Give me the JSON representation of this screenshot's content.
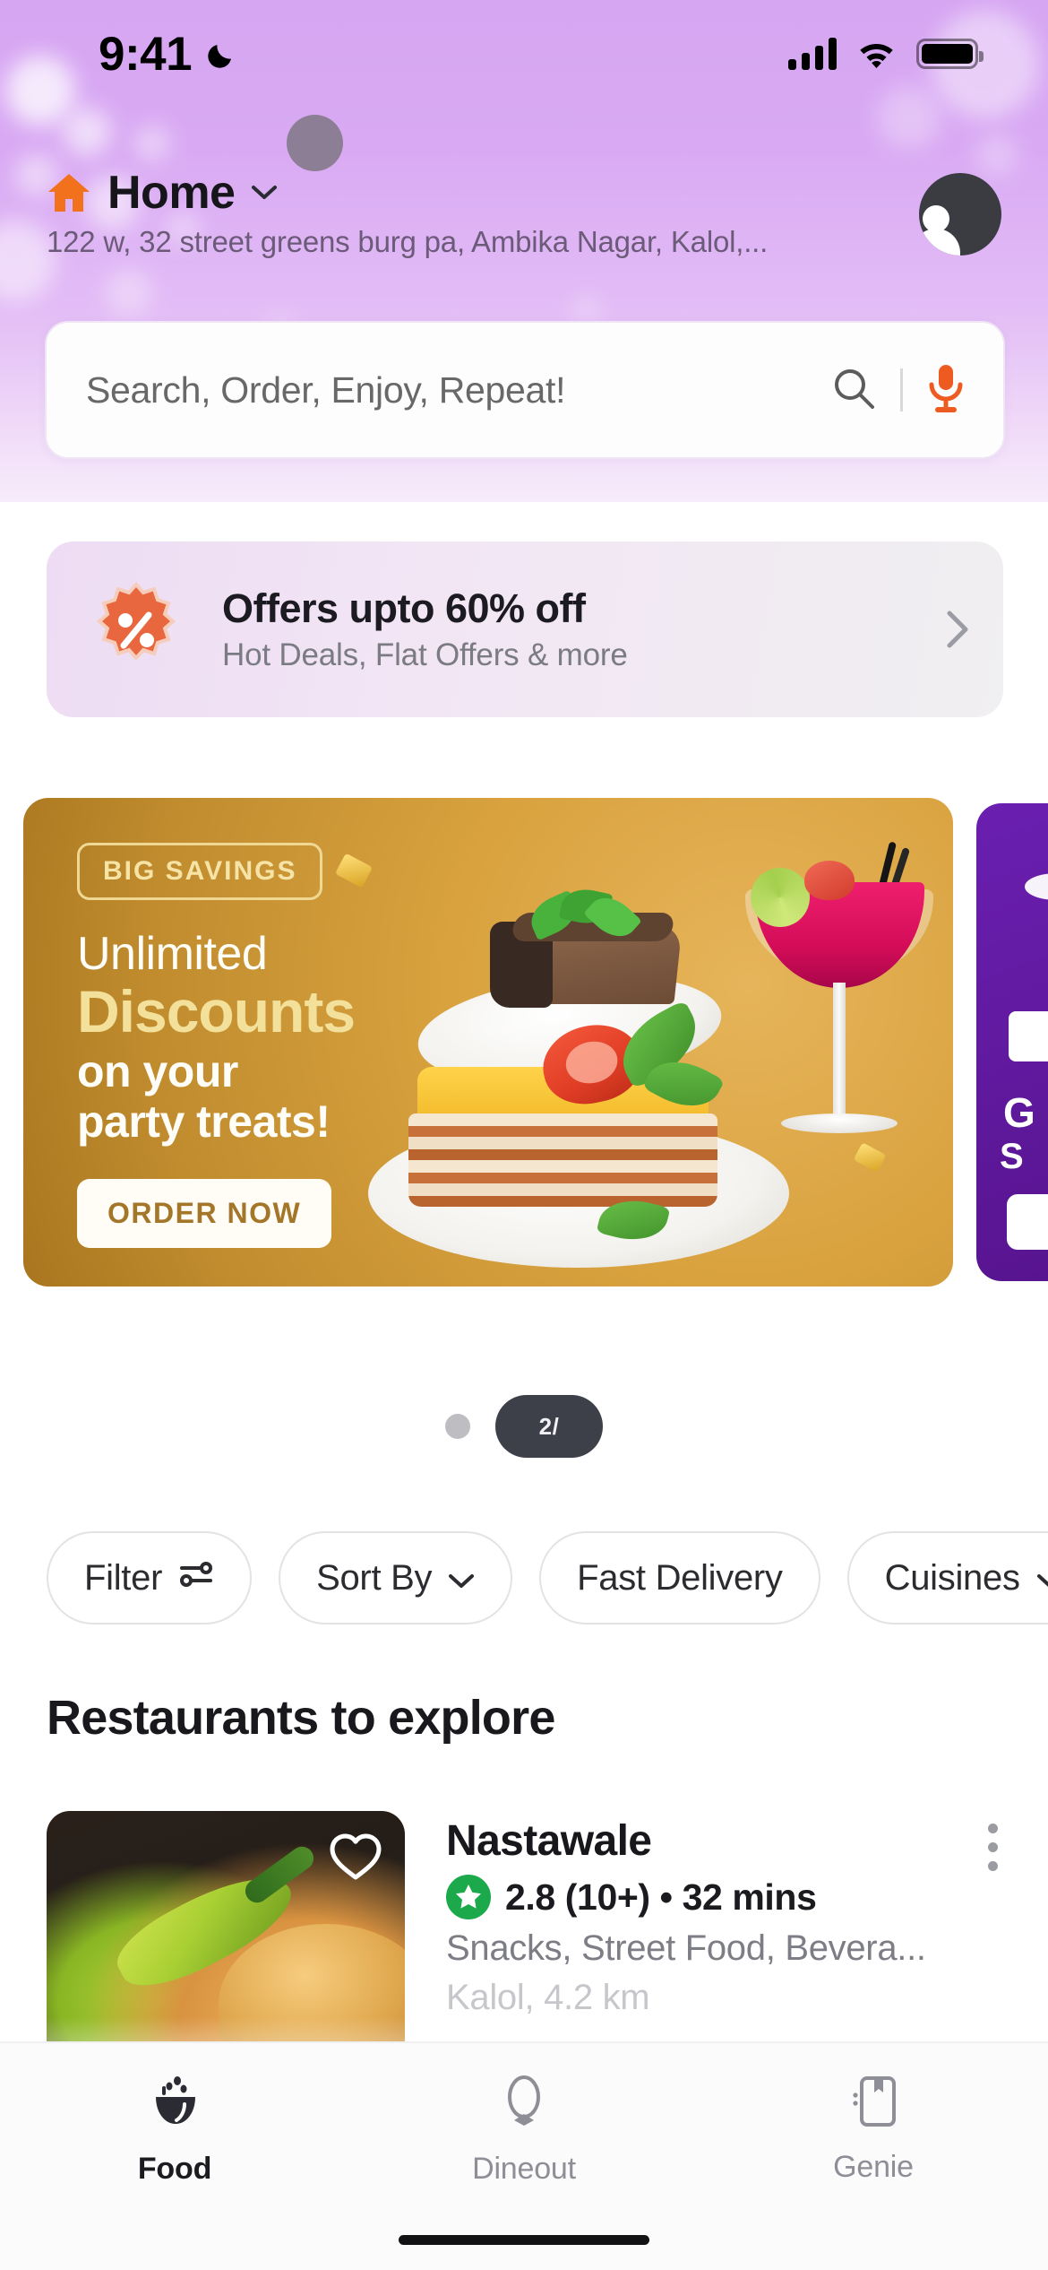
{
  "status_bar": {
    "time": "9:41",
    "dnd_icon": "crescent-moon-icon",
    "signal_icon": "cellular-signal-icon",
    "wifi_icon": "wifi-icon",
    "battery_icon": "battery-full-icon"
  },
  "header": {
    "home_icon": "house-icon",
    "label": "Home",
    "chevron_icon": "chevron-down-icon",
    "address": "122 w, 32 street greens burg pa, Ambika Nagar, Kalol,...",
    "avatar_icon": "user-avatar-icon"
  },
  "search": {
    "placeholder": "Search, Order, Enjoy, Repeat!",
    "search_icon": "search-icon",
    "mic_icon": "microphone-icon",
    "mic_color": "#EE5B20"
  },
  "offers_banner": {
    "badge_icon": "percent-badge-icon",
    "title": "Offers upto 60% off",
    "subtitle": "Hot Deals, Flat Offers & more",
    "chevron_icon": "chevron-right-icon",
    "badge_color": "#E8673F"
  },
  "promo_carousel": {
    "current_slide_label": "2/",
    "slides": [
      {
        "eyebrow": "BIG SAVINGS",
        "line1": "Unlimited",
        "line2": "Discounts",
        "line3": "on your\nparty treats!",
        "cta": "ORDER NOW",
        "bg_color": "#D09E3C",
        "accent_color": "#F2E09B"
      },
      {
        "line1": "G",
        "line2": "S",
        "bg_color": "#5F18A0"
      }
    ]
  },
  "filters": {
    "chips": [
      {
        "label": "Filter",
        "icon": "sliders-icon"
      },
      {
        "label": "Sort By",
        "icon": "chevron-down-icon"
      },
      {
        "label": "Fast Delivery",
        "icon": ""
      },
      {
        "label": "Cuisines",
        "icon": "chevron-down-icon"
      }
    ]
  },
  "restaurants_section": {
    "title": "Restaurants to explore",
    "items": [
      {
        "name": "Nastawale",
        "rating": "2.8 (10+) • 32 mins",
        "rating_badge_color": "#1BA94C",
        "categories": "Snacks, Street Food, Bevera...",
        "location": "Kalol, 4.2 km",
        "favorite_icon": "heart-outline-icon",
        "menu_icon": "more-vertical-icon"
      }
    ]
  },
  "bottom_nav": {
    "items": [
      {
        "label": "Food",
        "icon": "food-bowl-icon",
        "active": true
      },
      {
        "label": "Dineout",
        "icon": "bowtie-icon",
        "active": false
      },
      {
        "label": "Genie",
        "icon": "genie-bag-icon",
        "active": false
      }
    ]
  }
}
